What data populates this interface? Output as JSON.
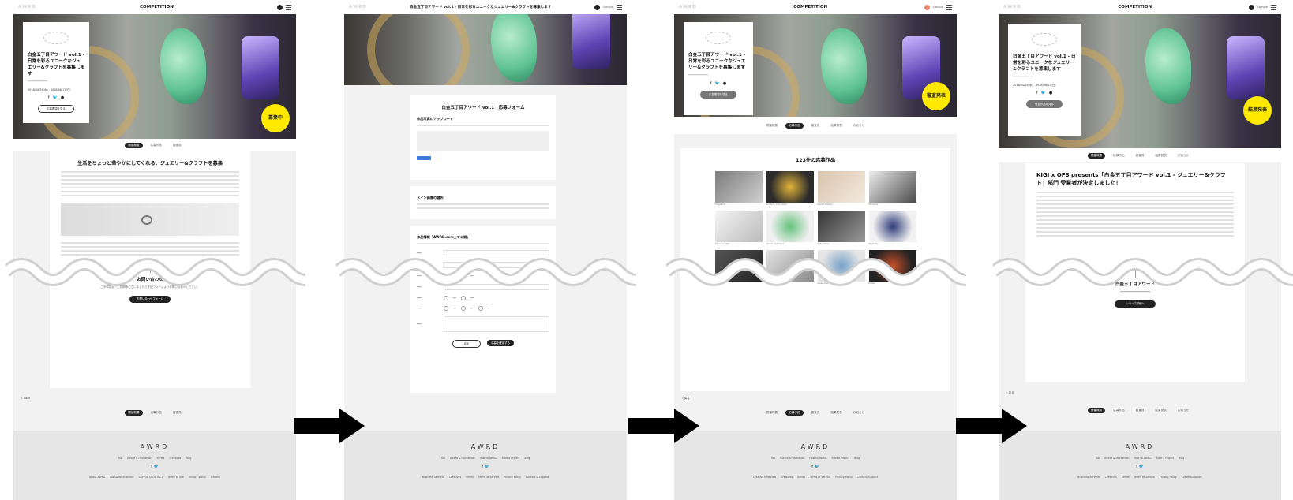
{
  "brand": "AWRD",
  "panel1": {
    "page_title": "COMPETITION",
    "card_title": "白金五丁目アワード vol.1 - 日常を彩るユニークなジュエリー&クラフトを募集します",
    "card_date": "2018/04/25(水) - 2018/06/17(日)",
    "card_button": "応募要項を見る",
    "badge": "募集中",
    "tabs": [
      "開催概要",
      "応募作品",
      "審査員"
    ],
    "content_title": "生活をちょっと華やかにしてくれる、ジュエリー&クラフトを募集",
    "contact_title": "お問い合わせ",
    "contact_text": "ご不明な点・ご質問等ございましたら下記フォームよりお問い合わせください。",
    "contact_button": "お問い合わせフォーム",
    "back_label": "Back",
    "footer_links": [
      "Top",
      "Award & Hackathon",
      "Series",
      "Creatives",
      "Blog"
    ],
    "footer_links2": [
      "About AWRD",
      "AWRD for Business",
      "SUPPORT/CONTACT",
      "Terms of Use",
      "privacy policy",
      "Infomal"
    ]
  },
  "panel2": {
    "page_title": "白金五丁目アワード vol.1 - 日常を彩るユニークなジュエリー&クラフトを募集します",
    "nav_user": "Sample",
    "form_title": "白金五丁目アワード vol.1　応募フォーム",
    "section1": "作品写真のアップロード",
    "section2": "メイン画像の選択",
    "section3": "作品情報「AWRD.com上で公開」",
    "cancel": "戻る",
    "submit": "応募を確定する",
    "footer_links": [
      "Top",
      "Award & Hackathon",
      "How to AWRD",
      "Start a Project",
      "Blog"
    ],
    "footer_links2": [
      "Business Services",
      "Creatives",
      "Series",
      "Terms of Service",
      "Privacy Policy",
      "Contact & Support"
    ]
  },
  "panel3": {
    "page_title": "COMPETITION",
    "nav_user": "Sample",
    "badge": "審査発表",
    "tabs": [
      "開催概要",
      "応募作品",
      "審査員",
      "結果発表",
      "お知らせ"
    ],
    "entries_title": "123件の応募作品",
    "entries": [
      "Fragment",
      "Ambition from earth",
      "Desert dreams",
      "Moonrise",
      "Traces of light",
      "Garden of flowers",
      "Gray stone",
      "Night sky",
      "Black",
      "Geometric bloom",
      "Glass drop",
      "Ember"
    ],
    "back_label": "戻る",
    "footer_links": [
      "Top",
      "Essential Operation",
      "How to AWRD",
      "Start a Project",
      "Blog"
    ],
    "footer_links2": [
      "Creative Interview",
      "Creatives",
      "Series",
      "Terms of Service",
      "Privacy Policy",
      "Contact/Support"
    ]
  },
  "panel4": {
    "page_title": "COMPETITION",
    "nav_user": "Sample",
    "badge": "結果発表",
    "card_button": "受賞作品を見る",
    "tabs": [
      "開催概要",
      "応募作品",
      "審査員",
      "結果発表",
      "お知らせ"
    ],
    "content_title": "KIGI x OFS presents「白金五丁目アワード vol.1 - ジュエリー&クラフト」部門 受賞者が決定しました！",
    "sub_title": "白金五丁目アワード",
    "sub_button": "シリーズ詳細へ",
    "back_label": "戻る",
    "footer_links": [
      "Top",
      "Award & Hackathon",
      "How to AWRD",
      "Start a Project",
      "Blog"
    ],
    "footer_links2": [
      "Business Services",
      "Creatives",
      "Series",
      "Terms of Service",
      "Privacy Policy",
      "Contact/Support"
    ]
  },
  "colors": {
    "badge": "#ffe900",
    "footer": "#e6e6e6",
    "panel_bg": "#f2f2f2",
    "arrow": "#000000"
  }
}
